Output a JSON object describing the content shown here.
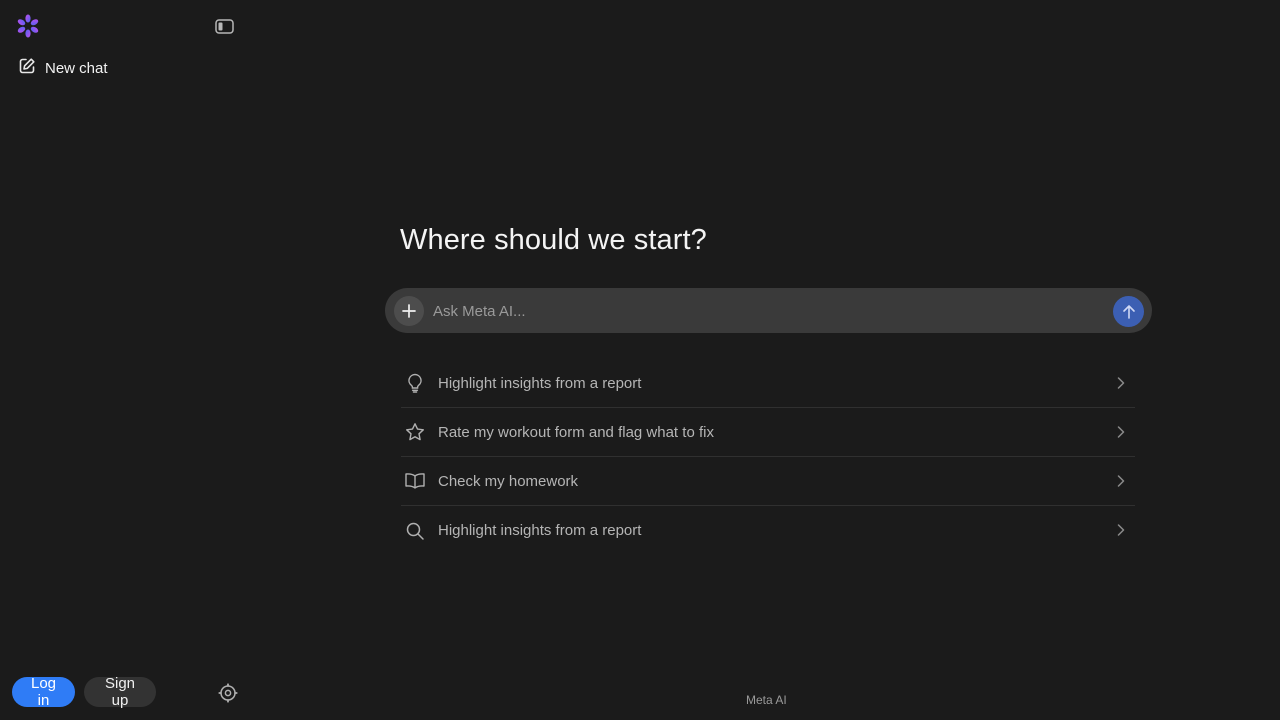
{
  "sidebar": {
    "logo_icon": "meta-ai-logo",
    "collapse_icon": "sidebar-toggle-icon",
    "new_chat": {
      "icon": "edit-icon",
      "label": "New chat"
    },
    "login_label": "Log in",
    "signup_label": "Sign up",
    "settings_icon": "gear-icon"
  },
  "main": {
    "heading": "Where should we start?",
    "composer": {
      "placeholder": "Ask Meta AI...",
      "value": "",
      "add_icon": "plus-icon",
      "send_icon": "arrow-up-icon"
    },
    "suggestions": [
      {
        "icon": "lightbulb-icon",
        "label": "Highlight insights from a report"
      },
      {
        "icon": "star-icon",
        "label": "Rate my workout form and flag what to fix"
      },
      {
        "icon": "book-icon",
        "label": "Check my homework"
      },
      {
        "icon": "search-icon",
        "label": "Highlight insights from a report"
      }
    ]
  },
  "footer": {
    "label": "Meta AI"
  },
  "colors": {
    "background": "#1b1b1b",
    "composer": "#3a3a3a",
    "login_button": "#2f7cf6",
    "send_button": "#3c5fb3",
    "logo_gradient": [
      "#a75cf2",
      "#4f62f0"
    ]
  }
}
